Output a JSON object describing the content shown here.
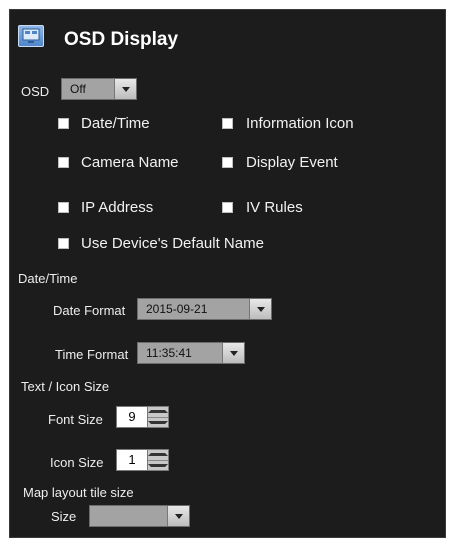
{
  "header": {
    "title": "OSD Display",
    "icon": "display-settings-icon"
  },
  "osd": {
    "label": "OSD",
    "value": "Off"
  },
  "checkboxes": {
    "date_time": "Date/Time",
    "information_icon": "Information Icon",
    "camera_name": "Camera Name",
    "display_event": "Display Event",
    "ip_address": "IP Address",
    "iv_rules": "IV Rules",
    "use_default_name": "Use Device's Default Name"
  },
  "date_time_section": {
    "heading": "Date/Time",
    "date_format_label": "Date Format",
    "date_format_value": "2015-09-21",
    "time_format_label": "Time Format",
    "time_format_value": "11:35:41"
  },
  "text_icon_section": {
    "heading": "Text / Icon Size",
    "font_size_label": "Font Size",
    "font_size_value": "9",
    "icon_size_label": "Icon Size",
    "icon_size_value": "1"
  },
  "map_section": {
    "heading": "Map layout tile size",
    "size_label": "Size",
    "size_value": ""
  }
}
